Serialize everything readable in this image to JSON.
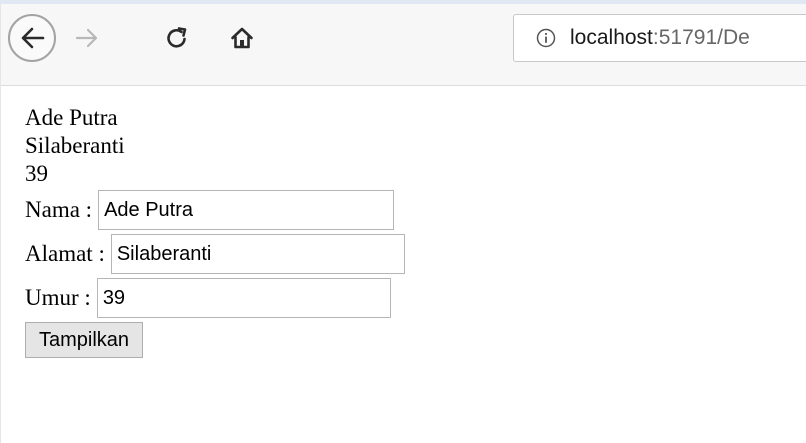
{
  "browser": {
    "url_host": "localhost",
    "url_rest": ":51791/De"
  },
  "output": {
    "nama": "Ade Putra",
    "alamat": "Silaberanti",
    "umur": "39"
  },
  "form": {
    "nama_label": "Nama :",
    "nama_value": "Ade Putra",
    "alamat_label": "Alamat :",
    "alamat_value": "Silaberanti",
    "umur_label": "Umur :",
    "umur_value": "39",
    "submit_label": "Tampilkan"
  },
  "icons": {
    "back": "back-arrow-icon",
    "forward": "forward-arrow-icon",
    "reload": "reload-icon",
    "home": "home-icon",
    "site_info": "info-icon"
  }
}
